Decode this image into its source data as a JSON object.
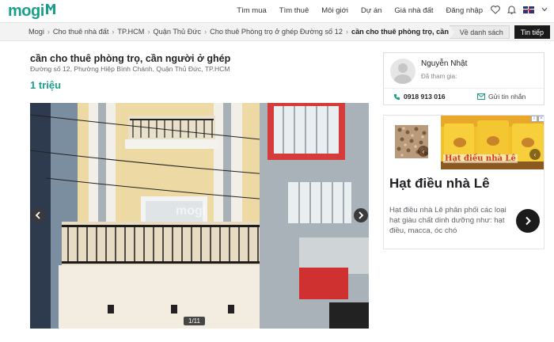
{
  "header": {
    "logo": "mogi",
    "nav": [
      "Tìm mua",
      "Tìm thuê",
      "Môi giới",
      "Dự án",
      "Giá nhà đất",
      "Đăng nhập"
    ],
    "icons": [
      "heart-icon",
      "bell-icon",
      "uk-flag-icon",
      "chevron-down-icon"
    ]
  },
  "breadcrumb": {
    "items": [
      "Mogi",
      "Cho thuê nhà đất",
      "TP.HCM",
      "Quận Thủ Đức",
      "Cho thuê Phòng trọ ở ghép Đường số 12"
    ],
    "current": "cần cho thuê phòng trọ, cần người",
    "back_label": "Về danh sách",
    "next_label": "Tin tiếp"
  },
  "listing": {
    "title": "cần cho thuê phòng trọ, cần người ở ghép",
    "address": "Đường số 12, Phường Hiệp Bình Chánh, Quận Thủ Đức, TP.HCM",
    "price": "1 triệu",
    "photo_counter": "1/11",
    "photo_watermark": "mogi"
  },
  "owner": {
    "name": "Nguyễn Nhật",
    "joined": "Đã tham gia:",
    "phone": "0918 913 016",
    "message_label": "Gửi tin nhắn"
  },
  "ad": {
    "image_caption": "Hạt điều nhà Lê",
    "title": "Hạt điều nhà Lê",
    "description": "Hạt điều nhà Lê phân phối các loại hạt giàu chất dinh dưỡng như: hạt điều, macca, óc chó"
  },
  "colors": {
    "brand": "#1a9f8b",
    "price": "#1a9f8b",
    "next_button": "#1b1b1b"
  }
}
